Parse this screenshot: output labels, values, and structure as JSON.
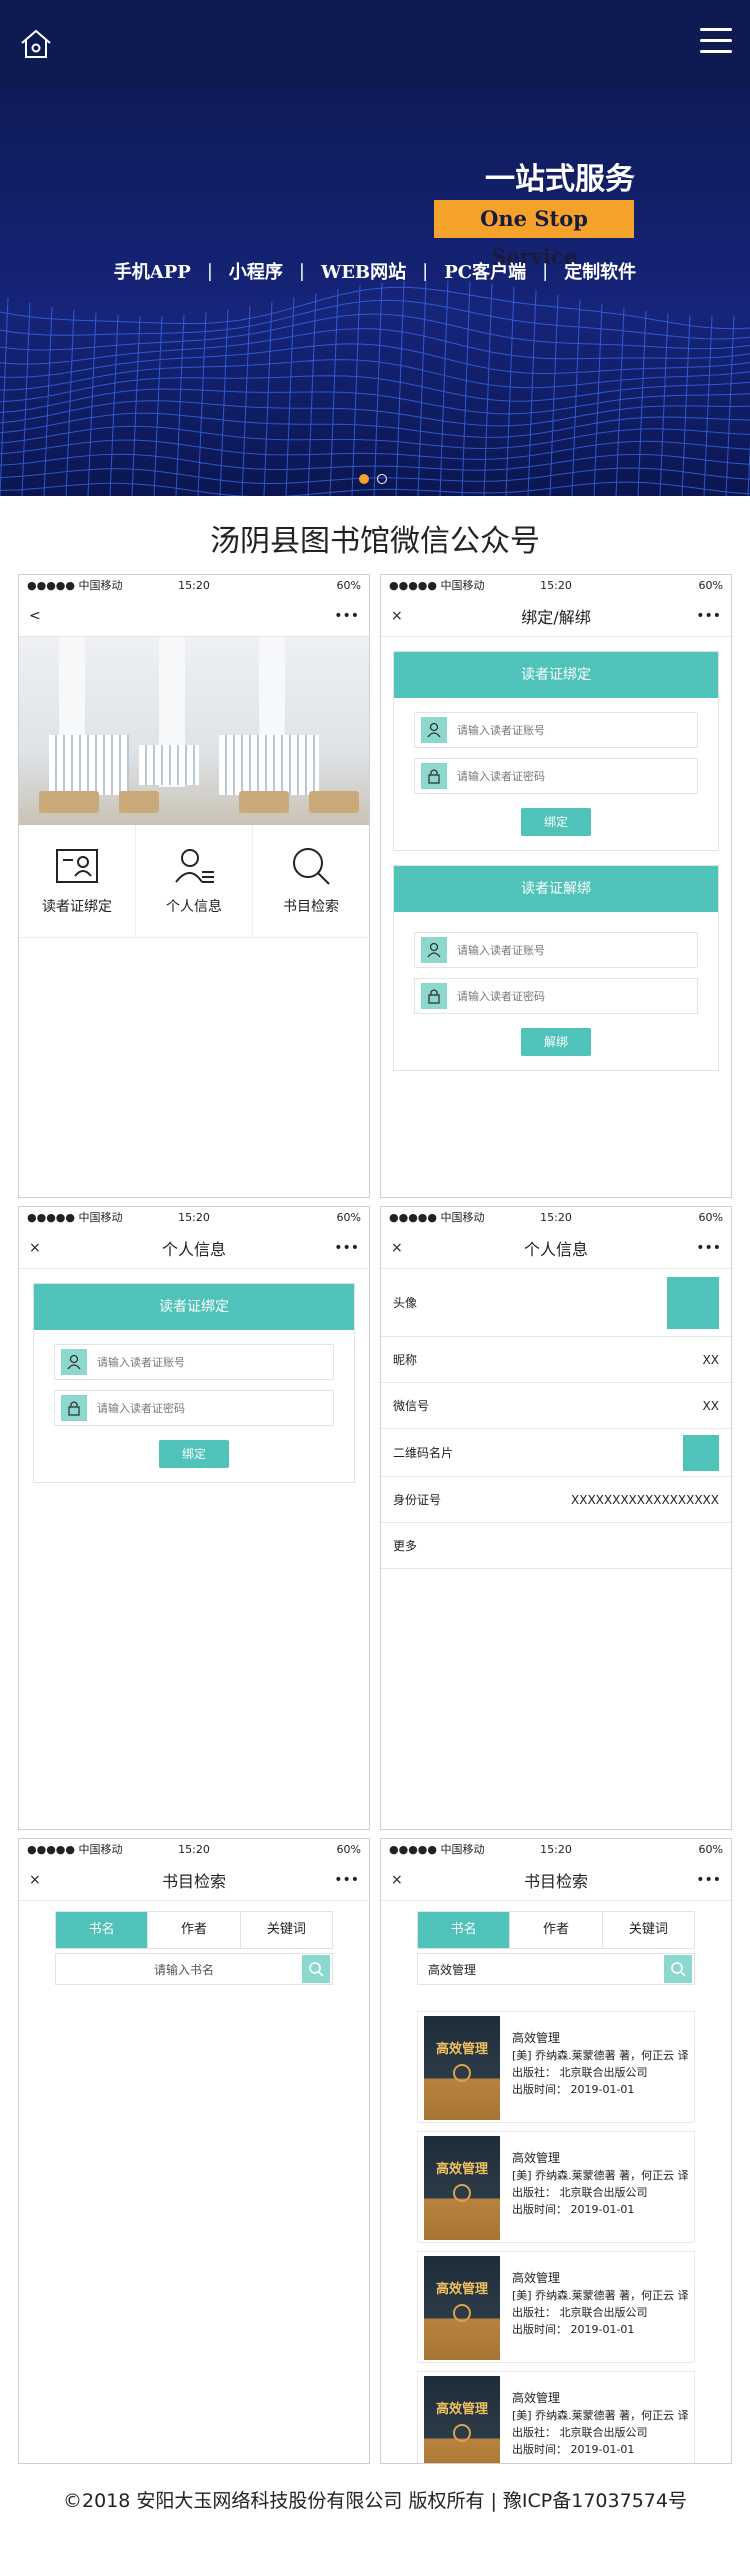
{
  "banner": {
    "slogan_cn": "一站式服务",
    "slogan_en": "One Stop Service",
    "services": [
      "手机APP",
      "小程序",
      "WEB网站",
      "PC客户端",
      "定制软件"
    ],
    "separator": "|",
    "accent": "#f4a22a"
  },
  "section_title": "汤阴县图书馆微信公众号",
  "status": {
    "carrier": "●●●●● 中国移动",
    "time": "15:20",
    "battery": "60%"
  },
  "nav": {
    "back": "<",
    "close": "×",
    "more": "•••"
  },
  "screens": {
    "home": {
      "menu": [
        "读者证绑定",
        "个人信息",
        "书目检索"
      ]
    },
    "bind": {
      "title": "绑定/解绑",
      "bind_header": "读者证绑定",
      "unbind_header": "读者证解绑",
      "account_placeholder": "请输入读者证账号",
      "password_placeholder": "请输入读者证密码",
      "bind_button": "绑定",
      "unbind_button": "解绑"
    },
    "info_bind": {
      "title": "个人信息",
      "header": "读者证绑定",
      "account_placeholder": "请输入读者证账号",
      "password_placeholder": "请输入读者证密码",
      "button": "绑定"
    },
    "info": {
      "title": "个人信息",
      "rows": [
        {
          "label": "头像",
          "value": ""
        },
        {
          "label": "昵称",
          "value": "XX"
        },
        {
          "label": "微信号",
          "value": "XX"
        },
        {
          "label": "二维码名片",
          "value": ""
        },
        {
          "label": "身份证号",
          "value": "XXXXXXXXXXXXXXXXXX"
        },
        {
          "label": "更多",
          "value": ""
        }
      ]
    },
    "search_empty": {
      "title": "书目检索",
      "tabs": [
        "书名",
        "作者",
        "关键词"
      ],
      "placeholder": "请输入书名"
    },
    "search_results": {
      "title": "书目检索",
      "tabs": [
        "书名",
        "作者",
        "关键词"
      ],
      "query": "高效管理",
      "books": [
        {
          "cover": "高效管理",
          "title": "高效管理",
          "author": "[美] 乔纳森.莱蒙德著 著，何正云 译",
          "publisher": "出版社： 北京联合出版公司",
          "date": "出版时间： 2019-01-01"
        },
        {
          "cover": "高效管理",
          "title": "高效管理",
          "author": "[美] 乔纳森.莱蒙德著 著，何正云 译",
          "publisher": "出版社： 北京联合出版公司",
          "date": "出版时间： 2019-01-01"
        },
        {
          "cover": "高效管理",
          "title": "高效管理",
          "author": "[美] 乔纳森.莱蒙德著 著，何正云 译",
          "publisher": "出版社： 北京联合出版公司",
          "date": "出版时间： 2019-01-01"
        },
        {
          "cover": "高效管理",
          "title": "高效管理",
          "author": "[美] 乔纳森.莱蒙德著 著，何正云 译",
          "publisher": "出版社： 北京联合出版公司",
          "date": "出版时间： 2019-01-01"
        }
      ]
    }
  },
  "footer": "©2018 安阳大玉网络科技股份有限公司 版权所有 | 豫ICP备17037574号",
  "colors": {
    "teal": "#4fc3b9",
    "navy": "#0e1a52"
  }
}
